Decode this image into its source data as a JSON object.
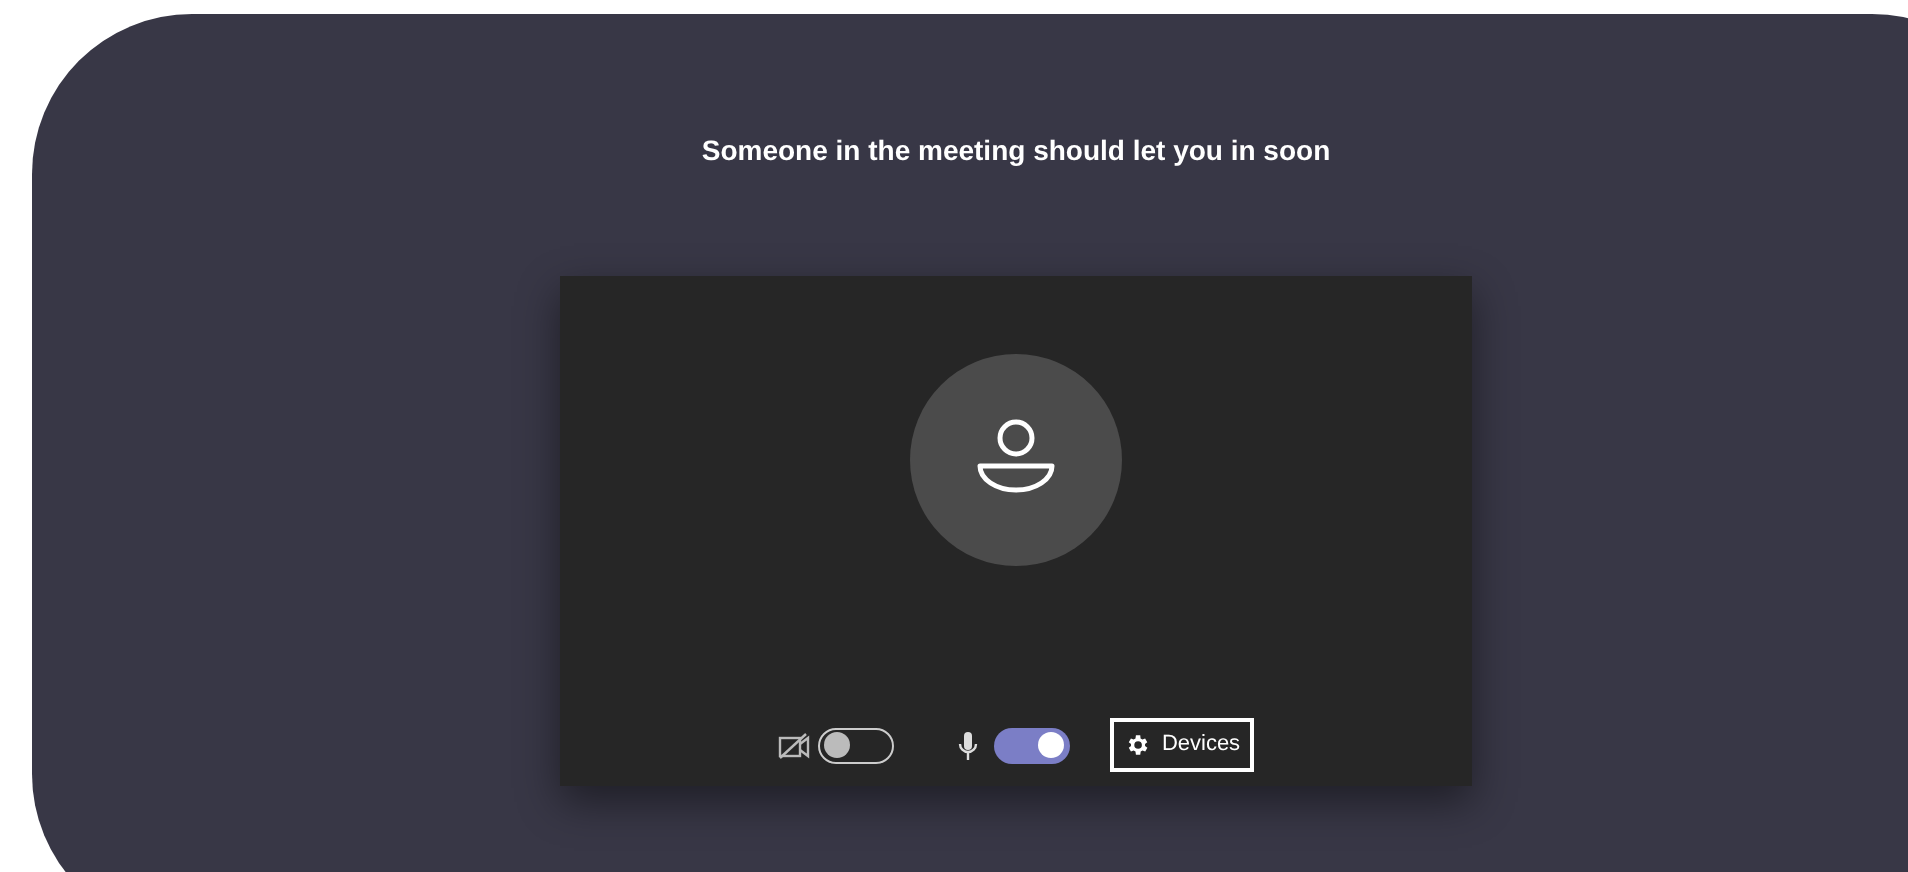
{
  "status_message": "Someone in the meeting should let you in soon",
  "controls": [
    {
      "kind": "camera",
      "on": false
    },
    {
      "kind": "microphone",
      "on": true
    }
  ],
  "devices_button": {
    "label": "Devices"
  }
}
